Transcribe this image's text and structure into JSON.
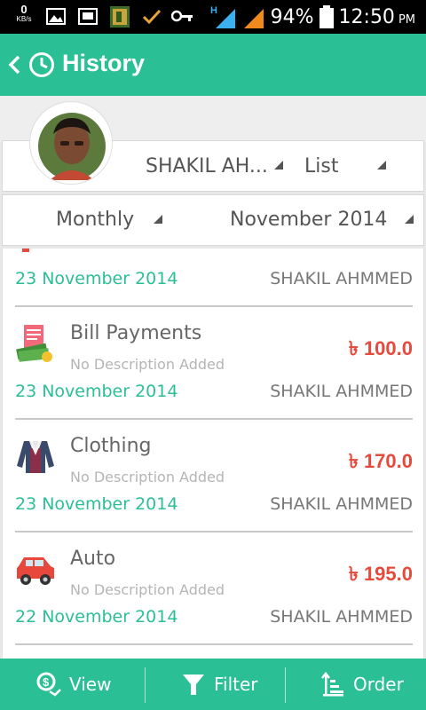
{
  "status_bar": {
    "net_speed": "0",
    "net_unit": "KB/s",
    "network_type": "H",
    "battery": "94%",
    "time": "12:50",
    "ampm": "PM",
    "icons": [
      "image-icon",
      "screen-icon",
      "app-icon",
      "check-icon",
      "key-icon",
      "signal-icon",
      "signal-icon-2",
      "battery-icon"
    ]
  },
  "action_bar": {
    "title": "History",
    "color": "#2bbf96"
  },
  "filters": {
    "user": "SHAKIL AH...",
    "view_mode": "List",
    "period": "Monthly",
    "month": "November 2014"
  },
  "list": {
    "partial_item": {
      "date": "23 November 2014",
      "person": "SHAKIL AHMMED"
    },
    "items": [
      {
        "category": "Bill Payments",
        "description": "No Description Added",
        "amount": "৳ 100.0",
        "date": "23 November 2014",
        "person": "SHAKIL AHMMED",
        "icon": "bill-payments-icon"
      },
      {
        "category": "Clothing",
        "description": "No Description Added",
        "amount": "৳ 170.0",
        "date": "23 November 2014",
        "person": "SHAKIL AHMMED",
        "icon": "clothing-icon"
      },
      {
        "category": "Auto",
        "description": "No Description Added",
        "amount": "৳ 195.0",
        "date": "22 November 2014",
        "person": "SHAKIL AHMMED",
        "icon": "auto-icon"
      }
    ]
  },
  "bottom_bar": {
    "view_label": "View",
    "filter_label": "Filter",
    "order_label": "Order"
  },
  "colors": {
    "accent": "#2bbf96",
    "amount": "#e64a3c"
  }
}
